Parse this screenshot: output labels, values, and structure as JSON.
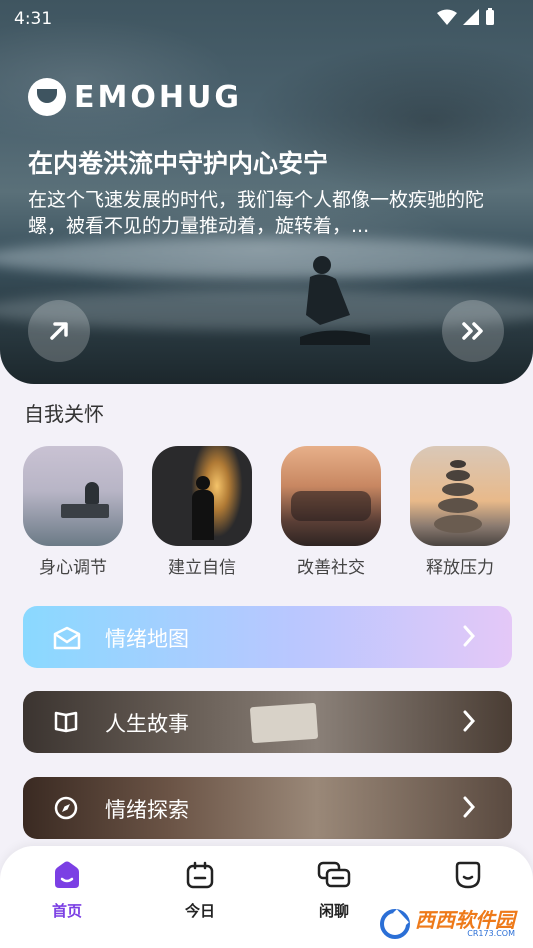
{
  "status_bar": {
    "time": "4:31"
  },
  "hero": {
    "brand": "EMOHUG",
    "title": "在内卷洪流中守护内心安宁",
    "description": "在这个飞速发展的时代，我们每个人都像一枚疾驰的陀螺，被看不见的力量推动着，旋转着，...",
    "open_icon": "arrow-up-right-icon",
    "next_icon": "double-chevron-right-icon"
  },
  "self_care": {
    "title": "自我关怀",
    "items": [
      {
        "label": "身心调节"
      },
      {
        "label": "建立自信"
      },
      {
        "label": "改善社交"
      },
      {
        "label": "释放压力"
      }
    ]
  },
  "cards": [
    {
      "label": "情绪地图",
      "icon": "map-envelope-icon"
    },
    {
      "label": "人生故事",
      "icon": "book-icon"
    },
    {
      "label": "情绪探索",
      "icon": "compass-icon"
    }
  ],
  "bottom_nav": {
    "items": [
      {
        "label": "首页",
        "icon": "home-icon",
        "active": true
      },
      {
        "label": "今日",
        "icon": "calendar-icon",
        "active": false
      },
      {
        "label": "闲聊",
        "icon": "chat-icon",
        "active": false
      },
      {
        "label": "",
        "icon": "face-icon",
        "active": false
      }
    ]
  },
  "watermark": {
    "text": "西西软件园",
    "sub": "CR173.COM"
  },
  "colors": {
    "accent": "#7b3fe4",
    "background": "#f3f1f8"
  }
}
